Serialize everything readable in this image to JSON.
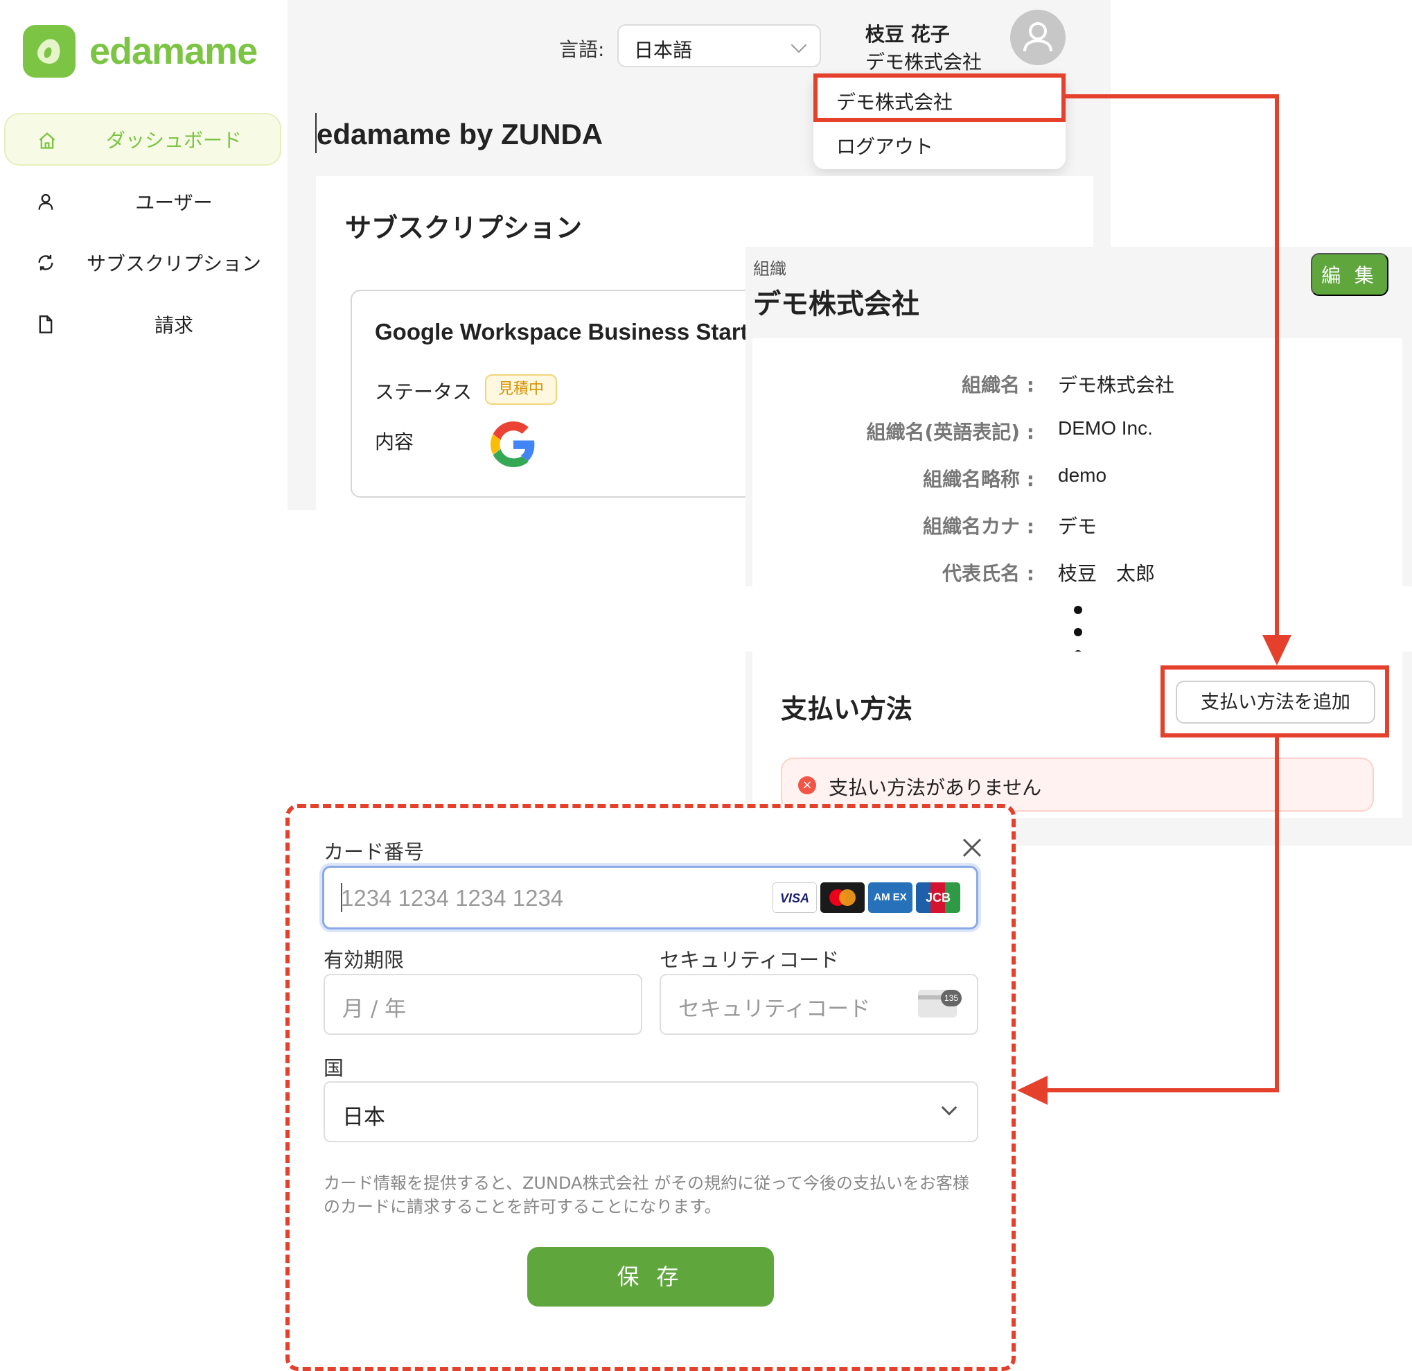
{
  "app": {
    "logo_text": "edamame",
    "title": "edamame by ZUNDA",
    "brand_color": "#7cc444",
    "accent_red": "#e5402c",
    "button_green": "#5fa63d"
  },
  "sidebar": {
    "items": [
      {
        "label": "ダッシュボード",
        "icon": "home-icon",
        "active": true
      },
      {
        "label": "ユーザー",
        "icon": "user-icon"
      },
      {
        "label": "サブスクリプション",
        "icon": "refresh-icon"
      },
      {
        "label": "請求",
        "icon": "document-icon"
      }
    ]
  },
  "header": {
    "language_label": "言語:",
    "language_value": "日本語",
    "user_name": "枝豆 花子",
    "user_org": "デモ株式会社"
  },
  "user_menu": {
    "org_item": "デモ株式会社",
    "logout_item": "ログアウト"
  },
  "subscription": {
    "title": "サブスクリプション",
    "product": "Google Workspace Business Starte",
    "status_label": "ステータス",
    "status_value": "見積中",
    "content_label": "内容"
  },
  "organization": {
    "kicker": "組織",
    "name": "デモ株式会社",
    "edit_label": "編 集",
    "fields": [
      {
        "label": "組織名 :",
        "value": "デモ株式会社"
      },
      {
        "label": "組織名(英語表記) :",
        "value": "DEMO Inc."
      },
      {
        "label": "組織名略称 :",
        "value": "demo"
      },
      {
        "label": "組織名カナ :",
        "value": "デモ"
      },
      {
        "label": "代表氏名 :",
        "value": "枝豆　太郎"
      }
    ]
  },
  "payment": {
    "title": "支払い方法",
    "add_button": "支払い方法を追加",
    "empty_message": "支払い方法がありません"
  },
  "card_form": {
    "card_number_label": "カード番号",
    "card_number_placeholder": "1234 1234 1234 1234",
    "brands": [
      "VISA",
      "Mastercard",
      "AMEX",
      "JCB"
    ],
    "brand_visa": "VISA",
    "brand_amex": "AM EX",
    "brand_jcb": "JCB",
    "expiry_label": "有効期限",
    "expiry_placeholder": "月 / 年",
    "cvc_label": "セキュリティコード",
    "cvc_placeholder": "セキュリティコード",
    "cvc_badge": "135",
    "country_label": "国",
    "country_value": "日本",
    "terms": "カード情報を提供すると、ZUNDA株式会社 がその規約に従って今後の支払いをお客様のカードに請求することを許可することになります。",
    "save_label": "保 存"
  }
}
